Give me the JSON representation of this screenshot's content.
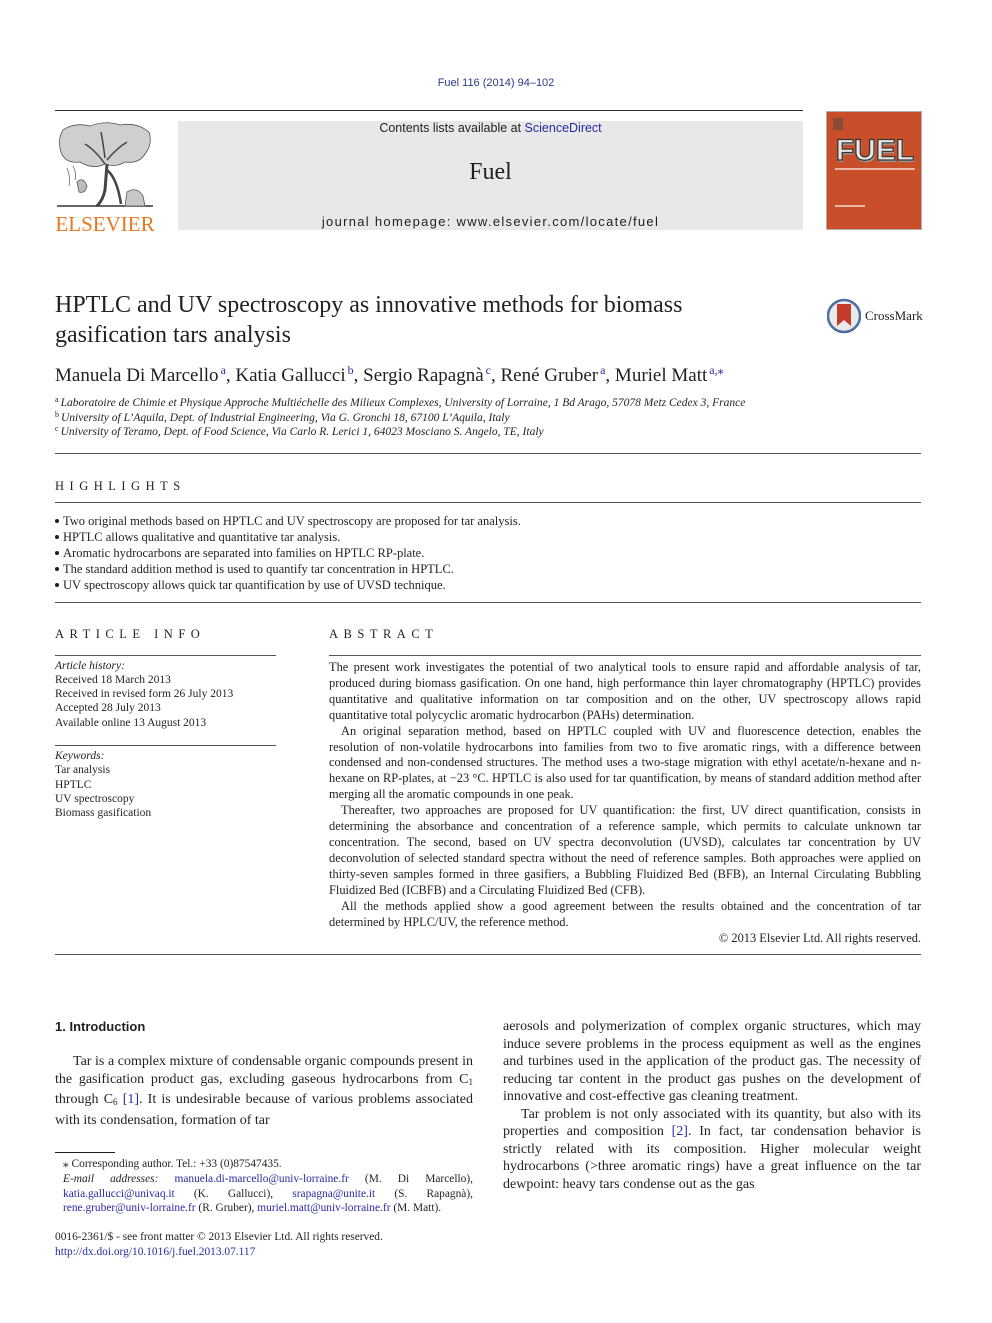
{
  "header": {
    "citation": "Fuel 116 (2014) 94–102",
    "contents_prefix": "Contents lists available at ",
    "contents_link": "ScienceDirect",
    "journal_name": "Fuel",
    "homepage": "journal homepage: www.elsevier.com/locate/fuel",
    "publisher_logo_text": "ELSEVIER",
    "cover_title": "FUEL",
    "colors": {
      "elsevier_orange": "#e87722",
      "cover_orange": "#c84f2a",
      "banner_gray": "#e8e8e8",
      "link_blue": "#2a2aa5"
    }
  },
  "article": {
    "title": "HPTLC and UV spectroscopy as innovative methods for biomass gasification tars analysis",
    "crossmark_label": "CrossMark",
    "authors": [
      {
        "name": "Manuela Di Marcello",
        "sup": "a"
      },
      {
        "name": "Katia Gallucci",
        "sup": "b"
      },
      {
        "name": "Sergio Rapagnà",
        "sup": "c"
      },
      {
        "name": "René Gruber",
        "sup": "a"
      },
      {
        "name": "Muriel Matt",
        "sup": "a,⁎"
      }
    ],
    "affiliations": [
      {
        "sup": "a",
        "text": "Laboratoire de Chimie et Physique Approche Multiéchelle des Milieux Complexes, University of Lorraine, 1 Bd Arago, 57078 Metz Cedex 3, France"
      },
      {
        "sup": "b",
        "text": "University of L’Aquila, Dept. of Industrial Engineering, Via G. Gronchi 18, 67100 L’Aquila, Italy"
      },
      {
        "sup": "c",
        "text": "University of Teramo, Dept. of Food Science, Via Carlo R. Lerici 1, 64023 Mosciano S. Angelo, TE, Italy"
      }
    ]
  },
  "highlights": {
    "heading": "HIGHLIGHTS",
    "items": [
      "Two original methods based on HPTLC and UV spectroscopy are proposed for tar analysis.",
      "HPTLC allows qualitative and quantitative tar analysis.",
      "Aromatic hydrocarbons are separated into families on HPTLC RP-plate.",
      "The standard addition method is used to quantify tar concentration in HPTLC.",
      "UV spectroscopy allows quick tar quantification by use of UVSD technique."
    ]
  },
  "article_info": {
    "heading": "ARTICLE INFO",
    "history_label": "Article history:",
    "history": [
      "Received 18 March 2013",
      "Received in revised form 26 July 2013",
      "Accepted 28 July 2013",
      "Available online 13 August 2013"
    ],
    "keywords_label": "Keywords:",
    "keywords": [
      "Tar analysis",
      "HPTLC",
      "UV spectroscopy",
      "Biomass gasification"
    ]
  },
  "abstract": {
    "heading": "ABSTRACT",
    "paragraphs": [
      "The present work investigates the potential of two analytical tools to ensure rapid and affordable analysis of tar, produced during biomass gasification. On one hand, high performance thin layer chromatography (HPTLC) provides quantitative and qualitative information on tar composition and on the other, UV spectroscopy allows rapid quantitative total polycyclic aromatic hydrocarbon (PAHs) determination.",
      "An original separation method, based on HPTLC coupled with UV and fluorescence detection, enables the resolution of non-volatile hydrocarbons into families from two to five aromatic rings, with a difference between condensed and non-condensed structures. The method uses a two-stage migration with ethyl acetate/n-hexane and n-hexane on RP-plates, at −23 °C. HPTLC is also used for tar quantification, by means of standard addition method after merging all the aromatic compounds in one peak.",
      "Thereafter, two approaches are proposed for UV quantification: the first, UV direct quantification, consists in determining the absorbance and concentration of a reference sample, which permits to calculate unknown tar concentration. The second, based on UV spectra deconvolution (UVSD), calculates tar concentration by UV deconvolution of selected standard spectra without the need of reference samples. Both approaches were applied on thirty-seven samples formed in three gasifiers, a Bubbling Fluidized Bed (BFB), an Internal Circulating Bubbling Fluidized Bed (ICBFB) and a Circulating Fluidized Bed (CFB).",
      "All the methods applied show a good agreement between the results obtained and the concentration of tar determined by HPLC/UV, the reference method."
    ],
    "copyright": "© 2013 Elsevier Ltd. All rights reserved."
  },
  "introduction": {
    "heading": "1. Introduction",
    "left_p1_a": "Tar is a complex mixture of condensable organic compounds present in the gasification product gas, excluding gaseous hydrocarbons from C",
    "left_p1_sub1": "1",
    "left_p1_b": " through C",
    "left_p1_sub2": "6",
    "left_p1_ref": "[1]",
    "left_p1_c": ". It is undesirable because of various problems associated with its condensation, formation of tar",
    "right_p1": "aerosols and polymerization of complex organic structures, which may induce severe problems in the process equipment as well as the engines and turbines used in the application of the product gas. The necessity of reducing tar content in the product gas pushes on the development of innovative and cost-effective gas cleaning treatment.",
    "right_p2_a": "Tar problem is not only associated with its quantity, but also with its properties and composition ",
    "right_p2_ref": "[2]",
    "right_p2_b": ". In fact, tar condensation behavior is strictly related with its composition. Higher molecular weight hydrocarbons (>three aromatic rings) have a great influence on the tar dewpoint: heavy tars condense out as the gas"
  },
  "footnotes": {
    "corresponding": "⁎ Corresponding author. Tel.: +33 (0)87547435.",
    "email_label": "E-mail addresses:",
    "emails": [
      {
        "address": "manuela.di-marcello@univ-lorraine.fr",
        "name": "(M. Di Marcello),"
      },
      {
        "address": "katia.gallucci@univaq.it",
        "name": "(K. Gallucci),"
      },
      {
        "address": "srapagna@unite.it",
        "name": "(S. Rapagnà),"
      },
      {
        "address": "rene.gruber@univ-lorraine.fr",
        "name": "(R. Gruber),"
      },
      {
        "address": "muriel.matt@univ-lorraine.fr",
        "name": "(M. Matt)."
      }
    ],
    "front_matter": "0016-2361/$ - see front matter © 2013 Elsevier Ltd. All rights reserved.",
    "doi": "http://dx.doi.org/10.1016/j.fuel.2013.07.117"
  }
}
